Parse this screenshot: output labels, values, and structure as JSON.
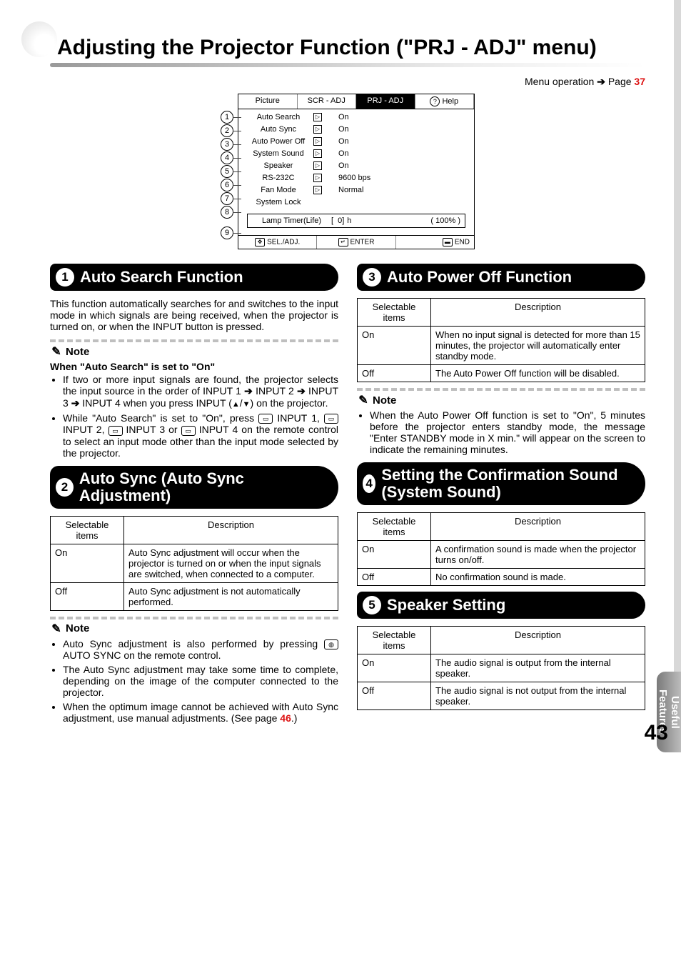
{
  "page": {
    "title": "Adjusting the Projector Function (\"PRJ - ADJ\" menu)",
    "menu_operation_prefix": "Menu operation",
    "menu_operation_page_word": "Page",
    "menu_operation_page_num": "37",
    "page_number": "43",
    "side_tab": "Useful Features"
  },
  "osd": {
    "tabs": {
      "picture": "Picture",
      "scr_adj": "SCR - ADJ",
      "prj_adj": "PRJ - ADJ",
      "help": "Help"
    },
    "rows": [
      {
        "label": "Auto Search",
        "val": "On"
      },
      {
        "label": "Auto Sync",
        "val": "On"
      },
      {
        "label": "Auto Power Off",
        "val": "On"
      },
      {
        "label": "System Sound",
        "val": "On"
      },
      {
        "label": "Speaker",
        "val": "On"
      },
      {
        "label": "RS-232C",
        "val": "9600 bps"
      },
      {
        "label": "Fan Mode",
        "val": "Normal"
      },
      {
        "label": "System Lock",
        "val": ""
      }
    ],
    "lamp": {
      "label": "Lamp Timer(Life)",
      "hours": "0",
      "h_unit": "h",
      "pct": "100%"
    },
    "foot": {
      "sel": "SEL./ADJ.",
      "enter": "ENTER",
      "end": "END"
    },
    "markers": [
      "1",
      "2",
      "3",
      "4",
      "5",
      "6",
      "7",
      "8",
      "9"
    ]
  },
  "sections": {
    "s1": {
      "num": "1",
      "title": "Auto Search Function",
      "para": "This function automatically searches for and switches to the input mode in which signals are being received, when the projector is turned on, or when the INPUT button is pressed.",
      "note_label": "Note",
      "note_bold": "When \"Auto Search\" is set to \"On\"",
      "bullet1a": "If two or more input signals are found, the projector selects the input source in the order of INPUT 1 ",
      "bullet1b": " INPUT 2 ",
      "bullet1c": " INPUT 3 ",
      "bullet1d": " INPUT 4 when you press INPUT (",
      "bullet1e": ") on the projector.",
      "bullet2a": "While \"Auto Search\" is set to \"On\", press ",
      "bullet2b": " INPUT 1, ",
      "bullet2c": " INPUT 2, ",
      "bullet2d": " INPUT 3 or ",
      "bullet2e": " INPUT 4 on the remote control to select an input mode other than the input mode selected by the projector."
    },
    "s2": {
      "num": "2",
      "title": "Auto Sync (Auto Sync Adjustment)",
      "th1": "Selectable items",
      "th2": "Description",
      "r_on": "On",
      "d_on": "Auto Sync adjustment will occur when the projector is turned on or when the input signals are switched, when connected to a computer.",
      "r_off": "Off",
      "d_off": "Auto Sync adjustment is not automatically performed.",
      "note_label": "Note",
      "n1a": "Auto Sync adjustment is also performed by pressing ",
      "n1b": " AUTO SYNC on the remote control.",
      "n2": "The Auto Sync adjustment may take some time to complete, depending on the image of the computer connected to the projector.",
      "n3a": "When the optimum image cannot be achieved with Auto Sync adjustment, use manual adjustments. (See page ",
      "n3b": ".)",
      "n3_page": "46"
    },
    "s3": {
      "num": "3",
      "title": "Auto Power Off Function",
      "th1": "Selectable items",
      "th2": "Description",
      "r_on": "On",
      "d_on": "When no input signal is detected for more than 15 minutes, the projector will automatically enter standby mode.",
      "r_off": "Off",
      "d_off": "The Auto Power Off function will be disabled.",
      "note_label": "Note",
      "n1": "When the Auto Power Off function is set to \"On\", 5 minutes before the projector enters standby mode, the message \"Enter STANDBY mode in X min.\" will appear on the screen to indicate the remaining minutes."
    },
    "s4": {
      "num": "4",
      "title": "Setting the Confirmation Sound (System Sound)",
      "th1": "Selectable items",
      "th2": "Description",
      "r_on": "On",
      "d_on": "A confirmation sound is made when the projector turns on/off.",
      "r_off": "Off",
      "d_off": "No confirmation sound is made."
    },
    "s5": {
      "num": "5",
      "title": "Speaker Setting",
      "th1": "Selectable items",
      "th2": "Description",
      "r_on": "On",
      "d_on": "The audio signal is output from the internal speaker.",
      "r_off": "Off",
      "d_off": "The audio signal is not output from the internal speaker."
    }
  }
}
